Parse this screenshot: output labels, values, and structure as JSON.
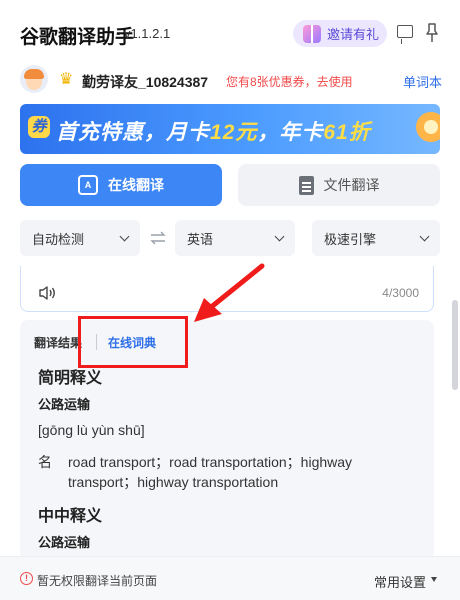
{
  "app": {
    "title": "谷歌翻译助手",
    "version": "- v1.1.2.1"
  },
  "header": {
    "invite_label": "邀请有礼"
  },
  "user": {
    "name": "勤劳译友_10824387",
    "coupon_text": "您有8张优惠券，去使用",
    "wordbook_label": "单词本"
  },
  "banner": {
    "badge": "券",
    "text_a": "首充特惠，月卡",
    "hl_a": "12元",
    "text_b": "，年卡",
    "hl_b": "61折"
  },
  "tabs": [
    {
      "label": "在线翻译",
      "active": true
    },
    {
      "label": "文件翻译",
      "active": false
    }
  ],
  "selects": {
    "source_lang": "自动检测",
    "target_lang": "英语",
    "engine": "极速引擎"
  },
  "input": {
    "char_count": "4/3000"
  },
  "result": {
    "tab_result": "翻译结果",
    "tab_dict": "在线词典",
    "section1_title": "简明释义",
    "term": "公路运输",
    "phonetic": "[gōng lù yùn shū]",
    "pos": "名",
    "definitions": "road transport；road transportation；highway transport；highway transportation",
    "section2_title": "中中释义",
    "term2": "公路运输"
  },
  "footer": {
    "status": "暂无权限翻译当前页面",
    "settings_label": "常用设置"
  },
  "colors": {
    "accent": "#3d86f5",
    "annotation": "#f01c1c",
    "warning": "#f04a4a"
  }
}
